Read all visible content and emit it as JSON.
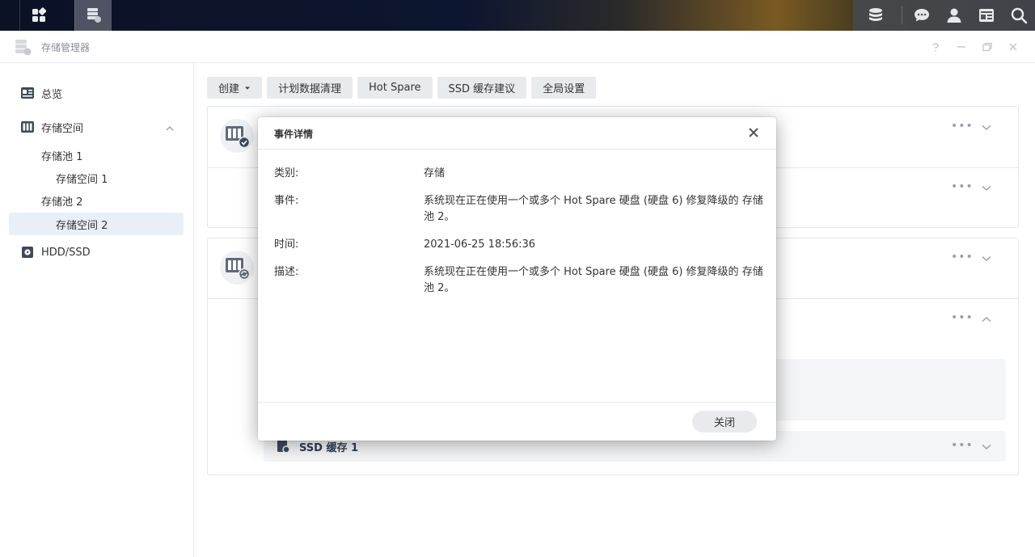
{
  "window": {
    "title": "存储管理器"
  },
  "sidebar": {
    "items": [
      {
        "label": "总览"
      },
      {
        "label": "存储空间"
      },
      {
        "label": "存储池 1"
      },
      {
        "label": "存储空间 1"
      },
      {
        "label": "存储池 2"
      },
      {
        "label": "存储空间 2"
      },
      {
        "label": "HDD/SSD"
      }
    ]
  },
  "toolbar": {
    "create_label": "创建",
    "scrub_label": "计划数据清理",
    "hotspare_label": "Hot Spare",
    "ssd_cache_label": "SSD 缓存建议",
    "global_label": "全局设置"
  },
  "content": {
    "ssd_cache_label": "SSD 缓存 1"
  },
  "dialog": {
    "title": "事件详情",
    "rows": [
      {
        "key": "类别:",
        "value": "存储"
      },
      {
        "key": "事件:",
        "value": "系统现在正在使用一个或多个 Hot Spare 硬盘 (硬盘 6) 修复降级的 存储池 2。"
      },
      {
        "key": "时间:",
        "value": "2021-06-25 18:56:36"
      },
      {
        "key": "描述:",
        "value": "系统现在正在使用一个或多个 Hot Spare 硬盘 (硬盘 6) 修复降级的 存储池 2。"
      }
    ],
    "close_label": "关闭"
  },
  "icons": {
    "taskbar_left": [
      "main-menu-icon",
      "storage-manager-app-icon"
    ],
    "taskbar_right": [
      "storage-widget-icon",
      "chat-icon",
      "user-icon",
      "widgets-icon",
      "search-icon"
    ],
    "window_controls": [
      "help-icon",
      "minimize-icon",
      "restore-icon",
      "close-icon"
    ]
  }
}
